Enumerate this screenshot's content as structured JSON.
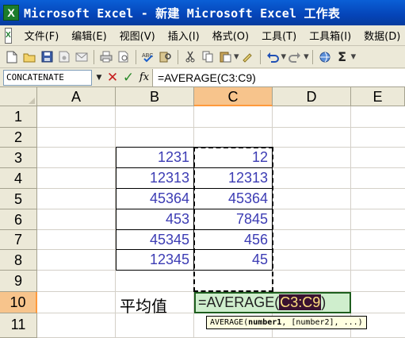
{
  "window": {
    "title": "Microsoft Excel - 新建 Microsoft Excel 工作表",
    "app_icon_letter": "X"
  },
  "menubar": {
    "doc_icon": "X",
    "items": [
      "文件(F)",
      "编辑(E)",
      "视图(V)",
      "插入(I)",
      "格式(O)",
      "工具(T)",
      "工具箱(I)",
      "数据(D)"
    ]
  },
  "toolbar": {
    "icons": [
      "new-icon",
      "open-icon",
      "save-icon",
      "permission-icon",
      "email-icon",
      "print-icon",
      "print-preview-icon",
      "spelling-icon",
      "research-icon",
      "cut-icon",
      "copy-icon",
      "paste-icon",
      "format-painter-icon",
      "undo-icon",
      "redo-icon",
      "hyperlink-icon",
      "autosum-icon"
    ],
    "autosum_glyph": "Σ"
  },
  "formula_bar": {
    "name_box": "CONCATENATE",
    "cancel_glyph": "✕",
    "enter_glyph": "✓",
    "fx_label": "fx",
    "formula": "=AVERAGE(C3:C9)"
  },
  "grid": {
    "columns": [
      "A",
      "B",
      "C",
      "D",
      "E"
    ],
    "active_column": "C",
    "rows": [
      "1",
      "2",
      "3",
      "4",
      "5",
      "6",
      "7",
      "8",
      "9",
      "10",
      "11"
    ],
    "active_row": "10",
    "column_b_values": [
      "1231",
      "12313",
      "45364",
      "453",
      "45345",
      "12345"
    ],
    "column_c_values": [
      "12",
      "12313",
      "45364",
      "7845",
      "456",
      "45"
    ],
    "label_b10": "平均值",
    "edit_cell": {
      "prefix": "=AVERAGE(",
      "ref": "C3:C9",
      "suffix": ")"
    },
    "tooltip": {
      "func": "AVERAGE(",
      "arg1": "number1",
      "rest": ", [number2], ...)"
    }
  }
}
